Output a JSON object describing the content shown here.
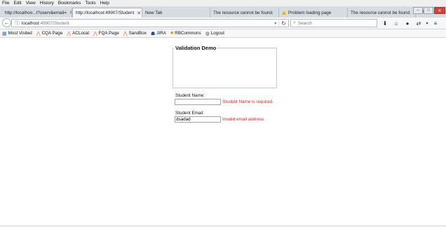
{
  "menu": [
    "File",
    "Edit",
    "View",
    "History",
    "Bookmarks",
    "Tools",
    "Help"
  ],
  "tabs": [
    {
      "label": "http://localhoo...t?userv&email=",
      "active": false
    },
    {
      "label": "http://localhost:49907/Student",
      "active": true
    },
    {
      "label": "New Tab",
      "active": false
    },
    {
      "label": "The resource cannot be found.",
      "active": false
    },
    {
      "label": "Problem loading page",
      "active": false,
      "icon": "warning-icon"
    },
    {
      "label": "The resource cannot be found.",
      "active": false
    }
  ],
  "window_buttons": {
    "minimize": "–",
    "maximize": "□",
    "close": "✕"
  },
  "address": {
    "host": "localhost",
    "path": ":49907/Student"
  },
  "search": {
    "placeholder": "Search"
  },
  "bookmarks": [
    {
      "label": "Most Visited",
      "icon": "bookmark-icon"
    },
    {
      "label": "CQA Page",
      "icon": "a-logo-icon"
    },
    {
      "label": "ACLocal",
      "icon": "a-logo-icon"
    },
    {
      "label": "FQA Page",
      "icon": "a-logo-icon"
    },
    {
      "label": "SandBox",
      "icon": "a-logo-icon"
    },
    {
      "label": "JIRA",
      "icon": "jira-icon"
    },
    {
      "label": "RBCommons",
      "icon": "folder-icon"
    },
    {
      "label": "Logout",
      "icon": "globe-icon"
    }
  ],
  "form": {
    "title": "Validation Demo",
    "name_label": "Student Name:",
    "name_value": "",
    "name_error": "Student Name is required.",
    "email_label": "Student Email:",
    "email_value": "dsadad",
    "email_error": "Invalid email address."
  },
  "colors": {
    "error": "#e02020",
    "accent_orange": "#e8732b"
  }
}
